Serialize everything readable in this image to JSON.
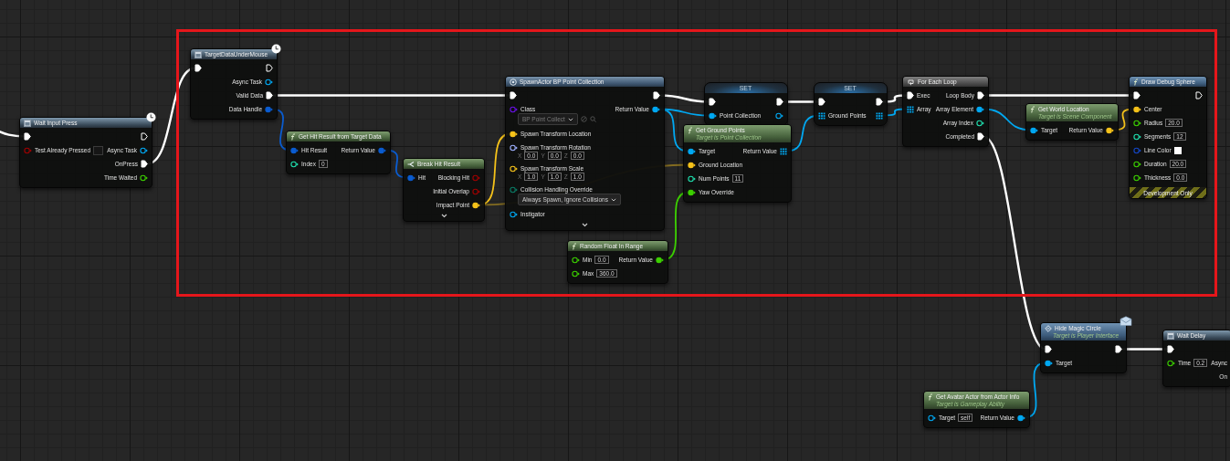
{
  "nodes": [
    {
      "kind": "latent",
      "title": "Wait Input Press",
      "badge": {
        "kind": "clock"
      },
      "rows": [
        {
          "in": {
            "kind": "exec",
            "connected": true
          },
          "out": {
            "kind": "exec",
            "connected": false
          }
        },
        {
          "in": {
            "label": "Test Already Pressed",
            "kind": "bool",
            "connected": false,
            "checked": false
          },
          "out": {
            "label": "Async Task",
            "kind": "object",
            "connected": false
          }
        },
        {
          "out": {
            "label": "OnPress",
            "kind": "exec",
            "connected": true
          }
        },
        {
          "out": {
            "label": "Time Waited",
            "kind": "float",
            "connected": false
          }
        }
      ]
    },
    {
      "kind": "latent",
      "title": "TargetDataUnderMouse",
      "badge": {
        "kind": "clock"
      },
      "rows": [
        {
          "in": {
            "kind": "exec",
            "connected": true
          },
          "out": {
            "kind": "exec",
            "connected": false
          }
        },
        {
          "out": {
            "label": "Async Task",
            "kind": "object",
            "connected": false
          }
        },
        {
          "out": {
            "label": "Valid Data",
            "kind": "exec",
            "connected": true
          }
        },
        {
          "out": {
            "label": "Data Handle",
            "kind": "struct",
            "connected": true
          }
        }
      ]
    },
    {
      "kind": "function",
      "title": "Get Hit Result from Target Data",
      "rows": [
        {
          "in": {
            "label": "Hit Result",
            "kind": "struct",
            "connected": true
          },
          "out": {
            "label": "Return Value",
            "kind": "struct",
            "connected": true
          }
        },
        {
          "in": {
            "label": "Index",
            "kind": "int",
            "connected": false,
            "value": "0"
          }
        }
      ]
    },
    {
      "kind": "break",
      "title": "Break Hit Result",
      "expand": true,
      "rows": [
        {
          "in": {
            "label": "Hit",
            "kind": "struct",
            "connected": true
          },
          "out": {
            "label": "Blocking Hit",
            "kind": "bool",
            "connected": false
          }
        },
        {
          "out": {
            "label": "Initial Overlap",
            "kind": "bool",
            "connected": false
          }
        },
        {
          "out": {
            "label": "Impact Point",
            "kind": "vector",
            "connected": true
          }
        }
      ]
    },
    {
      "kind": "spawn",
      "title": "SpawnActor BP Point Collection",
      "expand": true,
      "rows": [
        {
          "in": {
            "kind": "exec",
            "connected": true
          },
          "out": {
            "kind": "exec",
            "connected": true
          }
        },
        {
          "in": {
            "label": "Class",
            "kind": "class",
            "connected": false,
            "dropdown": "BP Point Collect",
            "disabled": true
          },
          "out": {
            "label": "Return Value",
            "kind": "object",
            "connected": true
          }
        },
        {
          "in": {
            "label": "Spawn Transform Location",
            "kind": "vector",
            "connected": true
          }
        },
        {
          "in": {
            "label": "Spawn Transform Rotation",
            "kind": "rotator",
            "connected": false,
            "fields": [
              {
                "axis": "X",
                "value": "0.0"
              },
              {
                "axis": "Y",
                "value": "0.0"
              },
              {
                "axis": "Z",
                "value": "0.0"
              }
            ]
          }
        },
        {
          "in": {
            "label": "Spawn Transform Scale",
            "kind": "vector",
            "connected": false,
            "fields": [
              {
                "axis": "X",
                "value": "1.0"
              },
              {
                "axis": "Y",
                "value": "1.0"
              },
              {
                "axis": "Z",
                "value": "1.0"
              }
            ]
          }
        },
        {
          "in": {
            "label": "Collision Handling Override",
            "kind": "enum",
            "connected": false,
            "dropdown": "Always Spawn, Ignore Collisions",
            "disabled": false
          }
        },
        {
          "in": {
            "label": "Instigator",
            "kind": "object",
            "connected": false
          }
        }
      ]
    },
    {
      "kind": "set",
      "title": "SET",
      "rows": [
        {
          "in": {
            "kind": "exec",
            "connected": true
          },
          "out": {
            "kind": "exec",
            "connected": true
          }
        },
        {
          "in": {
            "label": "Point Collection",
            "kind": "object",
            "connected": true
          },
          "out": {
            "kind": "object",
            "connected": false
          }
        }
      ]
    },
    {
      "kind": "function",
      "title": "Get Ground Points",
      "subtitle": "Target is Point Collection",
      "rows": [
        {
          "in": {
            "label": "Target",
            "kind": "object",
            "connected": true
          },
          "out": {
            "label": "Return Value",
            "kind": "array",
            "connected": true
          }
        },
        {
          "in": {
            "label": "Ground Location",
            "kind": "vector",
            "connected": true
          }
        },
        {
          "in": {
            "label": "Num Points",
            "kind": "int",
            "connected": false,
            "value": "11"
          }
        },
        {
          "in": {
            "label": "Yaw Override",
            "kind": "float",
            "connected": true
          }
        }
      ]
    },
    {
      "kind": "function",
      "title": "Random Float In Range",
      "rows": [
        {
          "in": {
            "label": "Min",
            "kind": "float",
            "connected": false,
            "value": "0.0"
          },
          "out": {
            "label": "Return Value",
            "kind": "float",
            "connected": true
          }
        },
        {
          "in": {
            "label": "Max",
            "kind": "float",
            "connected": false,
            "value": "360.0"
          }
        }
      ]
    },
    {
      "kind": "set",
      "title": "SET",
      "rows": [
        {
          "in": {
            "kind": "exec",
            "connected": true
          },
          "out": {
            "kind": "exec",
            "connected": true
          }
        },
        {
          "in": {
            "label": "Ground Points",
            "kind": "array",
            "connected": true
          },
          "out": {
            "kind": "array",
            "connected": true
          }
        }
      ]
    },
    {
      "kind": "macro",
      "title": "For Each Loop",
      "rows": [
        {
          "in": {
            "label": "Exec",
            "kind": "exec",
            "connected": true
          },
          "out": {
            "label": "Loop Body",
            "kind": "exec",
            "connected": true
          }
        },
        {
          "in": {
            "label": "Array",
            "kind": "array",
            "connected": true
          },
          "out": {
            "label": "Array Element",
            "kind": "object",
            "connected": true
          }
        },
        {
          "out": {
            "label": "Array Index",
            "kind": "int",
            "connected": false
          }
        },
        {
          "out": {
            "label": "Completed",
            "kind": "exec",
            "connected": true
          }
        }
      ]
    },
    {
      "kind": "function",
      "title": "Get World Location",
      "subtitle": "Target is Scene Component",
      "rows": [
        {
          "in": {
            "label": "Target",
            "kind": "object",
            "connected": true
          },
          "out": {
            "label": "Return Value",
            "kind": "vector",
            "connected": true
          }
        }
      ]
    },
    {
      "kind": "call",
      "title": "Draw Debug Sphere",
      "footer": "Development Only",
      "rows": [
        {
          "in": {
            "kind": "exec",
            "connected": true
          },
          "out": {
            "kind": "exec",
            "connected": false
          }
        },
        {
          "in": {
            "label": "Center",
            "kind": "vector",
            "connected": true
          }
        },
        {
          "in": {
            "label": "Radius",
            "kind": "float",
            "connected": false,
            "value": "20.0"
          }
        },
        {
          "in": {
            "label": "Segments",
            "kind": "int",
            "connected": false,
            "value": "12"
          }
        },
        {
          "in": {
            "label": "Line Color",
            "kind": "color",
            "connected": false,
            "color": "#ffffff"
          }
        },
        {
          "in": {
            "label": "Duration",
            "kind": "float",
            "connected": false,
            "value": "20.0"
          }
        },
        {
          "in": {
            "label": "Thickness",
            "kind": "float",
            "connected": false,
            "value": "0.0"
          }
        }
      ]
    },
    {
      "kind": "message",
      "title": "Hide Magic Circle",
      "subtitle": "Target is Player Interface",
      "badge": {
        "kind": "envelope"
      },
      "rows": [
        {
          "in": {
            "kind": "exec",
            "connected": true
          },
          "out": {
            "kind": "exec",
            "connected": true
          }
        },
        {
          "in": {
            "label": "Target",
            "kind": "object",
            "connected": true
          }
        }
      ]
    },
    {
      "kind": "latent",
      "title": "Wait Delay",
      "rows": [
        {
          "in": {
            "kind": "exec",
            "connected": true
          }
        },
        {
          "in": {
            "label": "Time",
            "kind": "float",
            "connected": false,
            "value": "0.2"
          },
          "out": {
            "label": "Async"
          }
        },
        {
          "out": {
            "label": "On"
          }
        }
      ]
    },
    {
      "kind": "function",
      "title": "Get Avatar Actor from Actor Info",
      "subtitle": "Target is Gameplay Ability",
      "rows": [
        {
          "in": {
            "label": "Target",
            "kind": "object",
            "connected": false,
            "value": "self"
          },
          "out": {
            "label": "Return Value",
            "kind": "object",
            "connected": true
          }
        }
      ]
    }
  ]
}
